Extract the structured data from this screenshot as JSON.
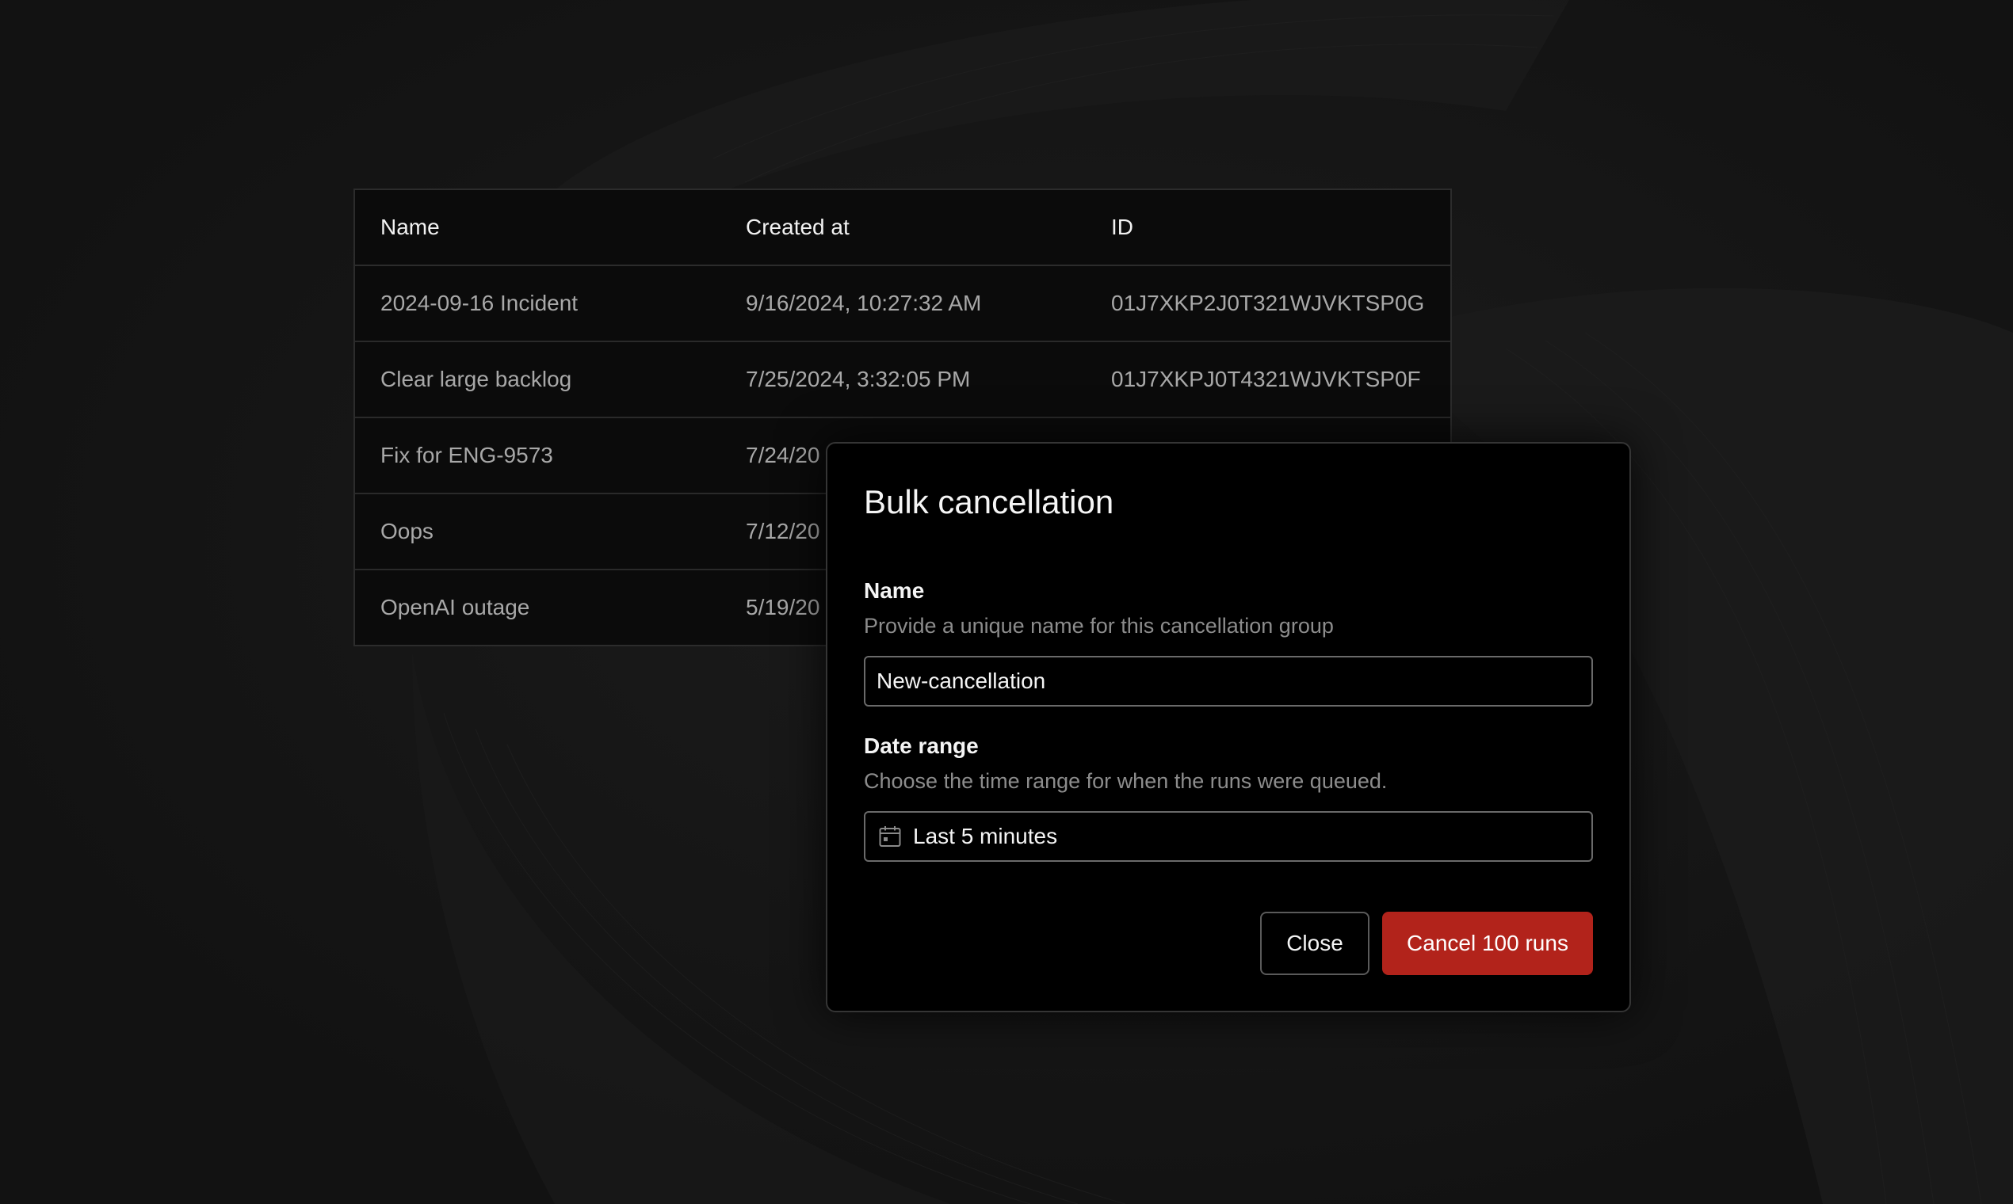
{
  "table": {
    "columns": [
      "Name",
      "Created at",
      "ID"
    ],
    "rows": [
      {
        "name": "2024-09-16 Incident",
        "created_at": "9/16/2024, 10:27:32 AM",
        "id": "01J7XKP2J0T321WJVKTSP0G"
      },
      {
        "name": "Clear large backlog",
        "created_at": "7/25/2024, 3:32:05 PM",
        "id": "01J7XKPJ0T4321WJVKTSP0F"
      },
      {
        "name": "Fix for ENG-9573",
        "created_at": "7/24/20",
        "id": ""
      },
      {
        "name": "Oops",
        "created_at": "7/12/20",
        "id": ""
      },
      {
        "name": "OpenAI outage",
        "created_at": "5/19/20",
        "id": ""
      }
    ]
  },
  "modal": {
    "title": "Bulk cancellation",
    "name_field": {
      "label": "Name",
      "help": "Provide a unique name for this cancellation group",
      "value": "New-cancellation"
    },
    "date_field": {
      "label": "Date range",
      "help": "Choose the time range for when the runs were queued.",
      "value": "Last 5 minutes",
      "icon": "calendar-icon"
    },
    "close_label": "Close",
    "confirm_label": "Cancel 100 runs"
  },
  "colors": {
    "background": "#141414",
    "danger": "#b2231b",
    "table_bg": "#0b0b0b",
    "muted_text": "#a8a8a8"
  }
}
